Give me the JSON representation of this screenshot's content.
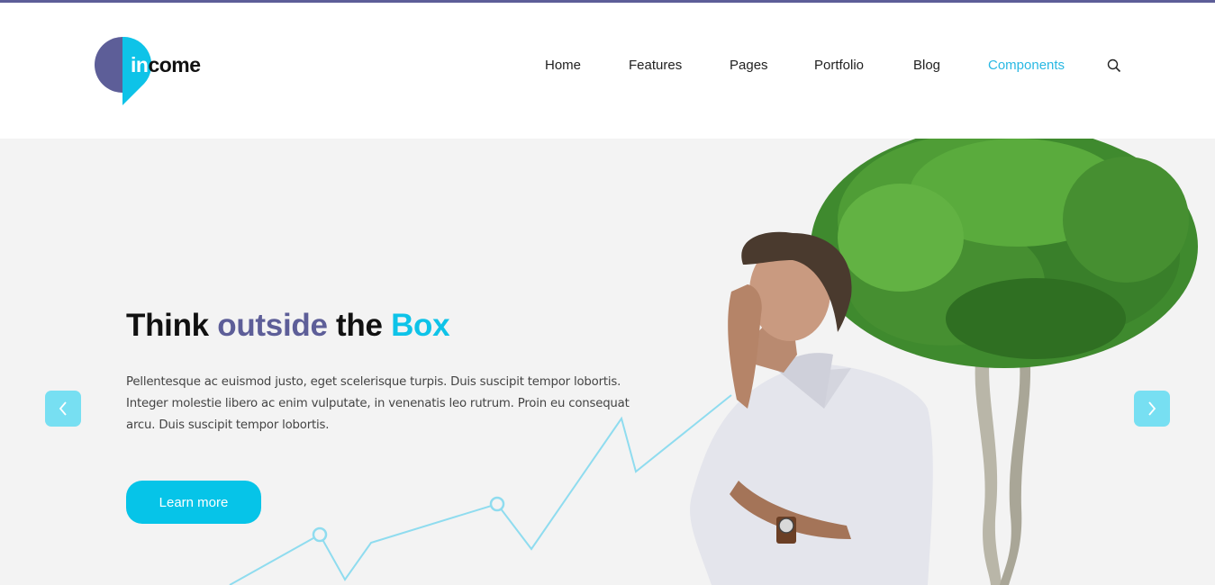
{
  "brand": {
    "logo_prefix": "in",
    "logo_suffix": "come",
    "colors": {
      "primary_purple": "#5d5e98",
      "accent_cyan": "#0ec3e8",
      "arrow_bg": "#77dff2",
      "hero_bg": "#f3f3f3"
    }
  },
  "nav": {
    "items": [
      {
        "label": "Home",
        "active": false
      },
      {
        "label": "Features",
        "active": false
      },
      {
        "label": "Pages",
        "active": false
      },
      {
        "label": "Portfolio",
        "active": false
      },
      {
        "label": "Blog",
        "active": false
      },
      {
        "label": "Components",
        "active": true
      }
    ],
    "search_icon": "search-icon"
  },
  "hero": {
    "title_parts": {
      "part1": "Think ",
      "part2": "outside",
      "part3": " the ",
      "part4": "Box"
    },
    "description": "Pellentesque ac euismod justo, eget scelerisque turpis. Duis suscipit tempor lobortis. Integer molestie libero ac enim vulputate, in venenatis leo rutrum. Proin eu consequat arcu. Duis suscipit tempor lobortis.",
    "cta_label": "Learn more",
    "prev_icon": "chevron-left-icon",
    "next_icon": "chevron-right-icon",
    "image_alt": "Man thinking beside a tree"
  }
}
